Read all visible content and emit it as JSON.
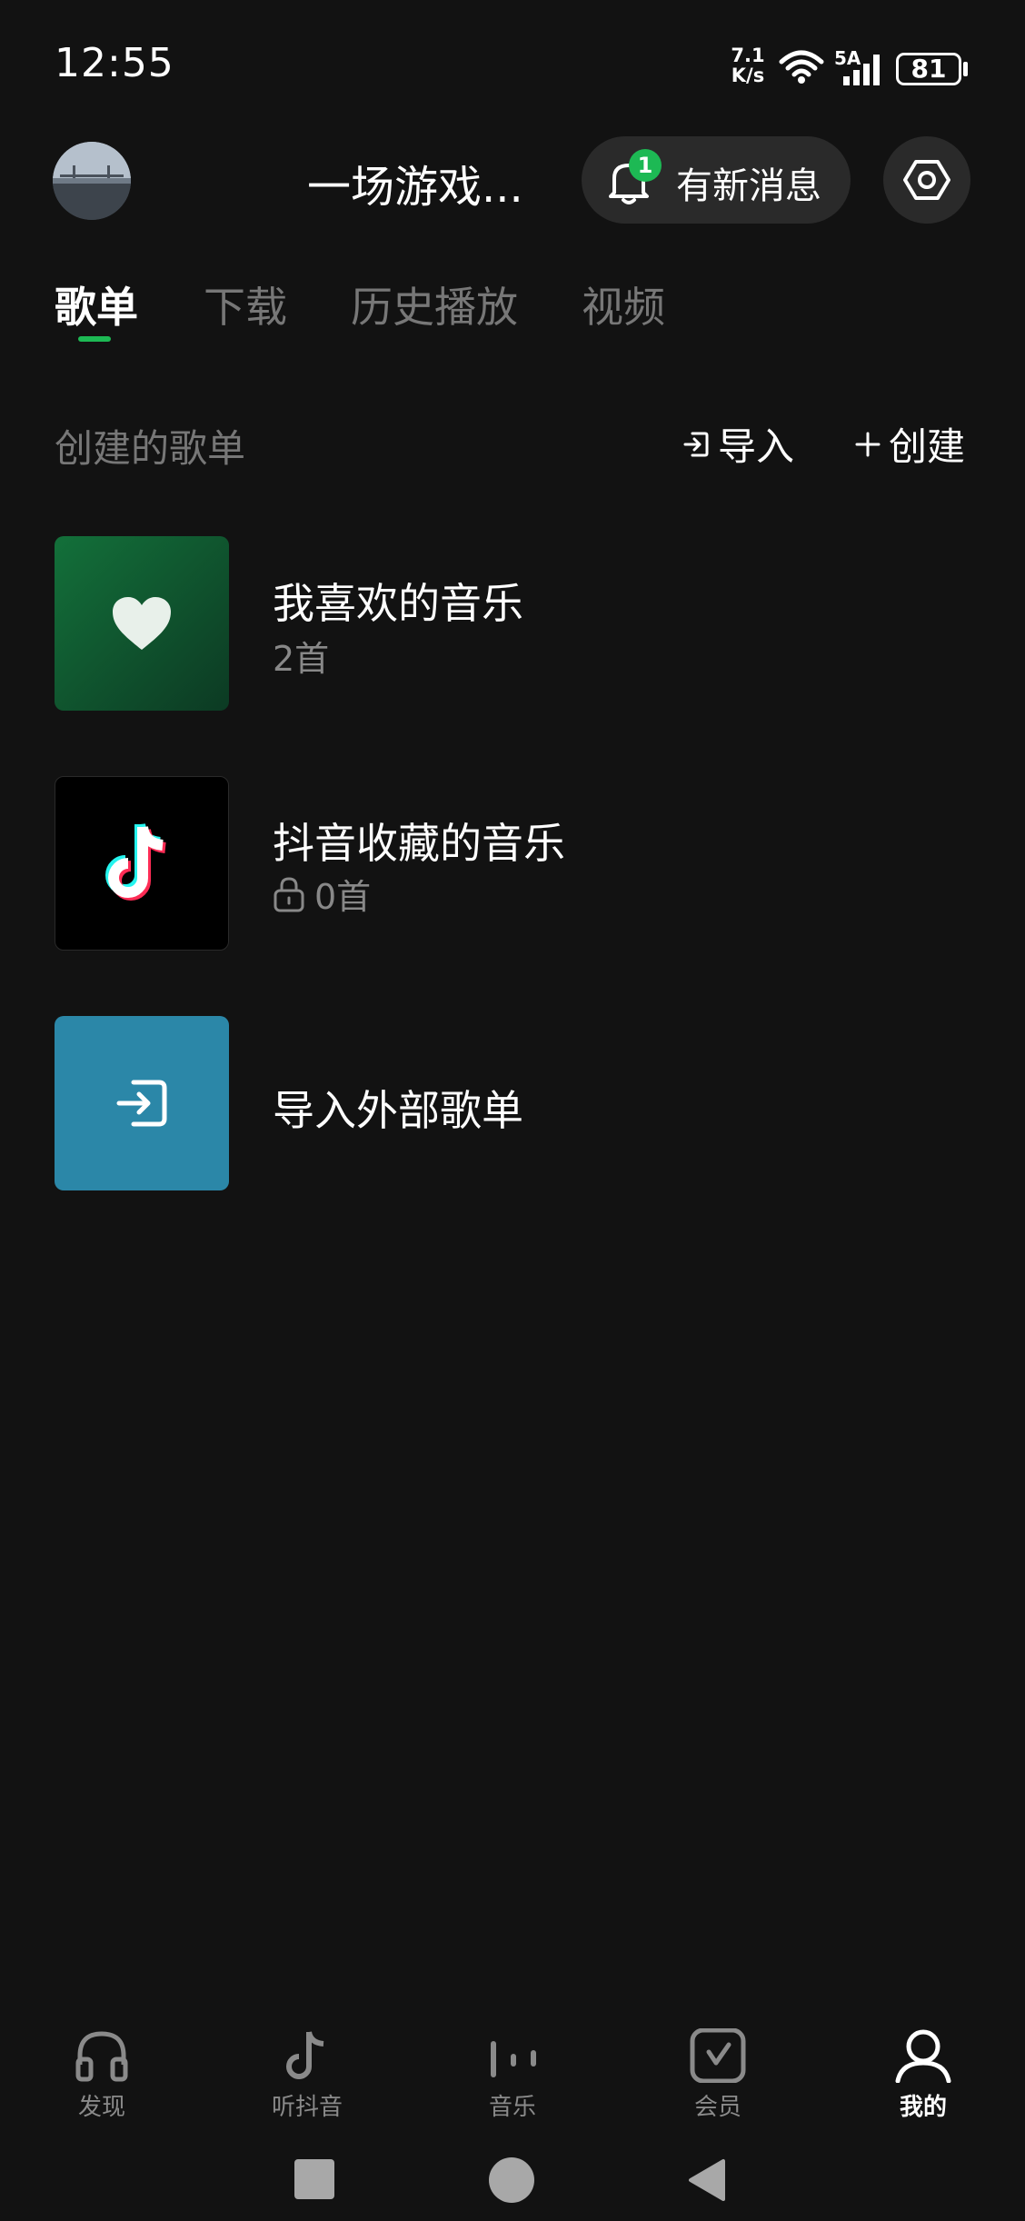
{
  "status_bar": {
    "time": "12:55",
    "net_speed_value": "7.1",
    "net_speed_unit": "K/s",
    "network_type": "5A",
    "battery": "81",
    "icons": [
      "wifi-icon",
      "signal-icon",
      "battery-icon"
    ]
  },
  "header": {
    "username": "一场游戏...",
    "messages_label": "有新消息",
    "messages_badge": "1",
    "settings_icon": "settings-hex-icon"
  },
  "tabs": [
    {
      "label": "歌单",
      "active": true
    },
    {
      "label": "下载",
      "active": false
    },
    {
      "label": "历史播放",
      "active": false
    },
    {
      "label": "视频",
      "active": false
    }
  ],
  "section": {
    "title": "创建的歌单",
    "import_label": "导入",
    "create_label": "创建"
  },
  "playlists": [
    {
      "title": "我喜欢的音乐",
      "subtitle": "2首",
      "icon": "heart-icon"
    },
    {
      "title": "抖音收藏的音乐",
      "subtitle": "0首",
      "icon": "douyin-logo-icon",
      "locked": true
    },
    {
      "title": "导入外部歌单",
      "icon": "import-icon"
    }
  ],
  "bottom_nav": [
    {
      "label": "发现",
      "icon": "headphones-icon",
      "active": false
    },
    {
      "label": "听抖音",
      "icon": "douyin-note-icon",
      "active": false
    },
    {
      "label": "音乐",
      "icon": "equalizer-icon",
      "active": false
    },
    {
      "label": "会员",
      "icon": "vip-icon",
      "active": false
    },
    {
      "label": "我的",
      "icon": "user-icon",
      "active": true
    }
  ],
  "colors": {
    "background": "#121212",
    "accent": "#1db954",
    "liked_cover": "#13703a",
    "import_cover": "#2b87a8"
  }
}
